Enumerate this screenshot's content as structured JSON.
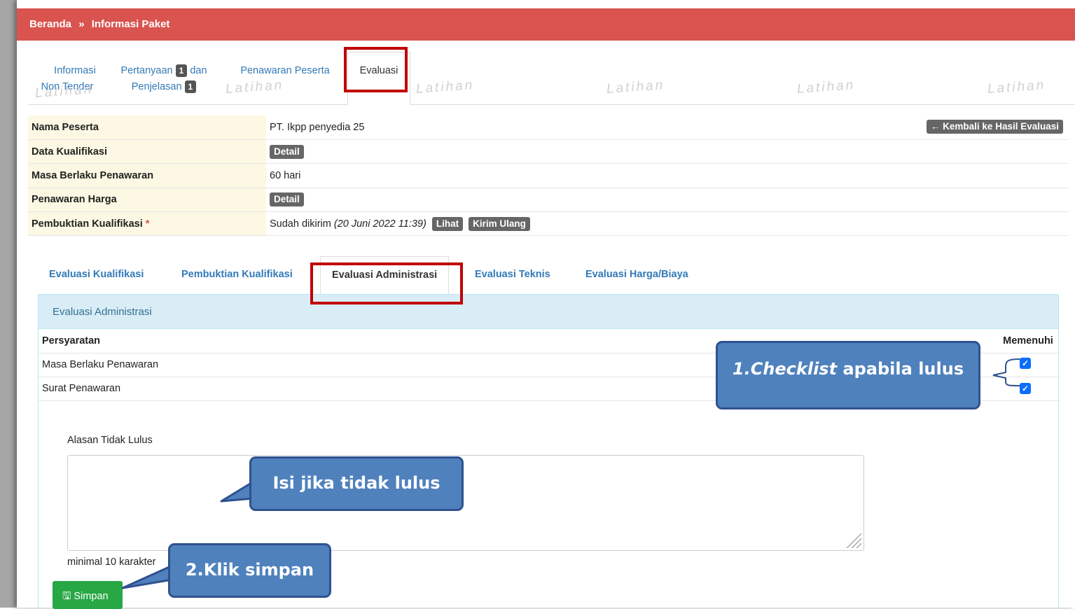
{
  "breadcrumb": {
    "home": "Beranda",
    "sep": "»",
    "current": "Informasi Paket"
  },
  "nav_tabs": [
    {
      "line1": "Informasi",
      "line2": "Non Tender"
    },
    {
      "line1": "Pertanyaan",
      "badge": "1",
      "line1b": "dan",
      "line2": "Penjelasan",
      "badge2": "1"
    },
    {
      "line1": "Penawaran Peserta"
    },
    {
      "line1": "Evaluasi"
    }
  ],
  "watermark": "Latihan",
  "info": {
    "nama_peserta_label": "Nama Peserta",
    "nama_peserta_value": "PT. Ikpp penyedia 25",
    "back_button": "Kembali ke Hasil Evaluasi",
    "data_kualifikasi_label": "Data Kualifikasi",
    "detail_label": "Detail",
    "masa_berlaku_label": "Masa Berlaku Penawaran",
    "masa_berlaku_value": "60 hari",
    "penawaran_harga_label": "Penawaran Harga",
    "pembuktian_label": "Pembuktian Kualifikasi",
    "required_mark": "*",
    "pembuktian_status": "Sudah dikirim",
    "pembuktian_date": "(20 Juni 2022 11:39)",
    "lihat_label": "Lihat",
    "kirim_ulang_label": "Kirim Ulang"
  },
  "eval_tabs": [
    "Evaluasi Kualifikasi",
    "Pembuktian Kualifikasi",
    "Evaluasi Administrasi",
    "Evaluasi Teknis",
    "Evaluasi Harga/Biaya"
  ],
  "panel": {
    "title": "Evaluasi Administrasi",
    "col_requirement": "Persyaratan",
    "col_meets": "Memenuhi",
    "rows": [
      {
        "label": "Masa Berlaku Penawaran",
        "checked": true
      },
      {
        "label": "Surat Penawaran",
        "checked": true
      }
    ],
    "alasan_label": "Alasan Tidak Lulus",
    "alasan_value": "",
    "minimal_note": "minimal 10 karakter",
    "save_button": "Simpan"
  },
  "callouts": {
    "checklist_em": "1.Checklist",
    "checklist_rest": " apabila lulus",
    "isi": "Isi jika tidak lulus",
    "klik": "2.Klik simpan"
  },
  "colors": {
    "topbar": "#d9534f",
    "link": "#337ab7",
    "callout": "#4f81bd",
    "highlight_box": "#c00000",
    "save": "#28a745"
  }
}
